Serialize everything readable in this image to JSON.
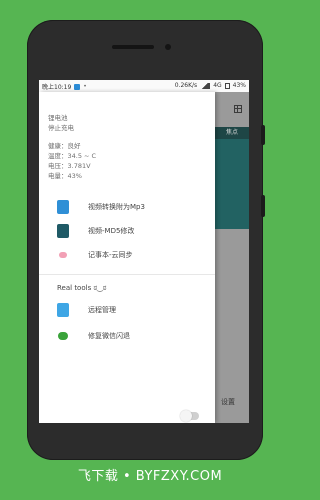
{
  "status_bar": {
    "time": "晚上10:19",
    "speed": "0.26K/s",
    "network": "4G",
    "battery": "43%"
  },
  "device_info": {
    "title": "锂电池",
    "charging": "停止充电",
    "health": "健康：良好",
    "temperature": "温度：34.5 ~ C",
    "voltage": "电压：3.781V",
    "level": "电量：43%"
  },
  "menu": {
    "items": [
      {
        "label": "视频转换附为Mp3",
        "icon": "audio-file-icon"
      },
      {
        "label": "视频-MD5修改",
        "icon": "edit-file-icon"
      },
      {
        "label": "记事本-云同步",
        "icon": "notes-icon"
      }
    ]
  },
  "real_tools": {
    "title": "Real tools ಠ‿ಠ",
    "items": [
      {
        "label": "远程管理",
        "icon": "remote-icon"
      },
      {
        "label": "修复微信闪退",
        "icon": "wechat-icon"
      }
    ]
  },
  "background_app": {
    "tab": "焦点",
    "settings": "设置"
  },
  "toggle": {
    "state": "off"
  },
  "watermark": "飞下载 • BYFZXY.COM"
}
